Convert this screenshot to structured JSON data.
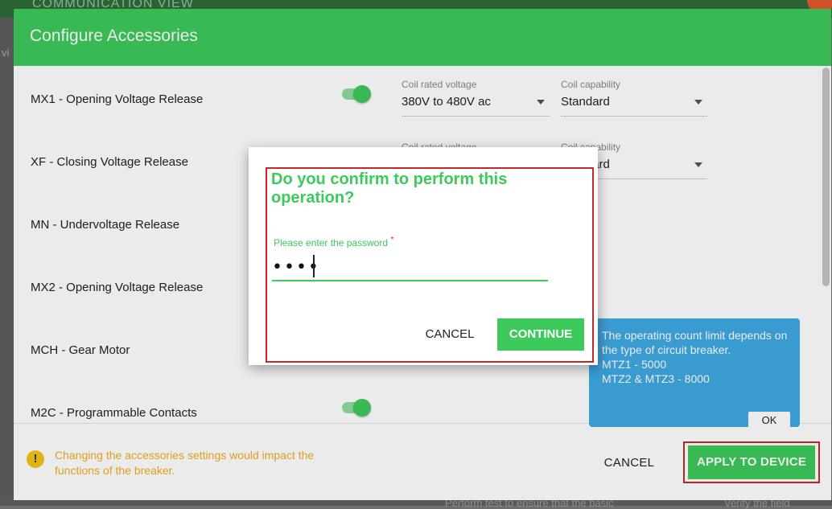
{
  "background": {
    "top_bar_text": "COMMUNICATION VIEW",
    "side_text": "vi",
    "bottom_left_text": "Perform test to ensure that the basic",
    "bottom_right_text": "Verify the field"
  },
  "modal": {
    "title": "Configure Accessories",
    "rows": [
      {
        "label": "MX1 - Opening Voltage Release",
        "toggle_on": true,
        "coil_voltage_label": "Coil rated voltage",
        "coil_voltage_value": "380V to 480V ac",
        "coil_capability_label": "Coil capability",
        "coil_capability_value": "Standard"
      },
      {
        "label": "XF - Closing Voltage Release",
        "coil_voltage_label": "Coil rated voltage",
        "coil_capability_label": "Coil capability",
        "coil_capability_value": "Standard"
      },
      {
        "label": "MN - Undervoltage Release"
      },
      {
        "label": "MX2 - Opening Voltage Release"
      },
      {
        "label": "MCH - Gear Motor"
      },
      {
        "label": "M2C - Programmable Contacts",
        "toggle_on": true
      }
    ],
    "footer": {
      "warning_icon": "!",
      "warning_text": "Changing the accessories settings would impact the functions of the breaker.",
      "cancel_label": "CANCEL",
      "apply_label": "APPLY TO DEVICE"
    }
  },
  "tooltip": {
    "lines": [
      "The operating count limit depends on the type of circuit breaker.",
      "MTZ1 - 5000",
      "MTZ2 & MTZ3 - 8000"
    ],
    "ok_label": "OK"
  },
  "dialog": {
    "title": "Do you confirm to perform this operation?",
    "password_label": "Please enter the password",
    "required_mark": "*",
    "password_value": "••••",
    "cancel_label": "CANCEL",
    "continue_label": "CONTINUE"
  },
  "colors": {
    "accent_green": "#3dc95c",
    "warning": "#f0ad1f",
    "tooltip_blue": "#3fa9e3",
    "highlight_red": "#c62828"
  }
}
